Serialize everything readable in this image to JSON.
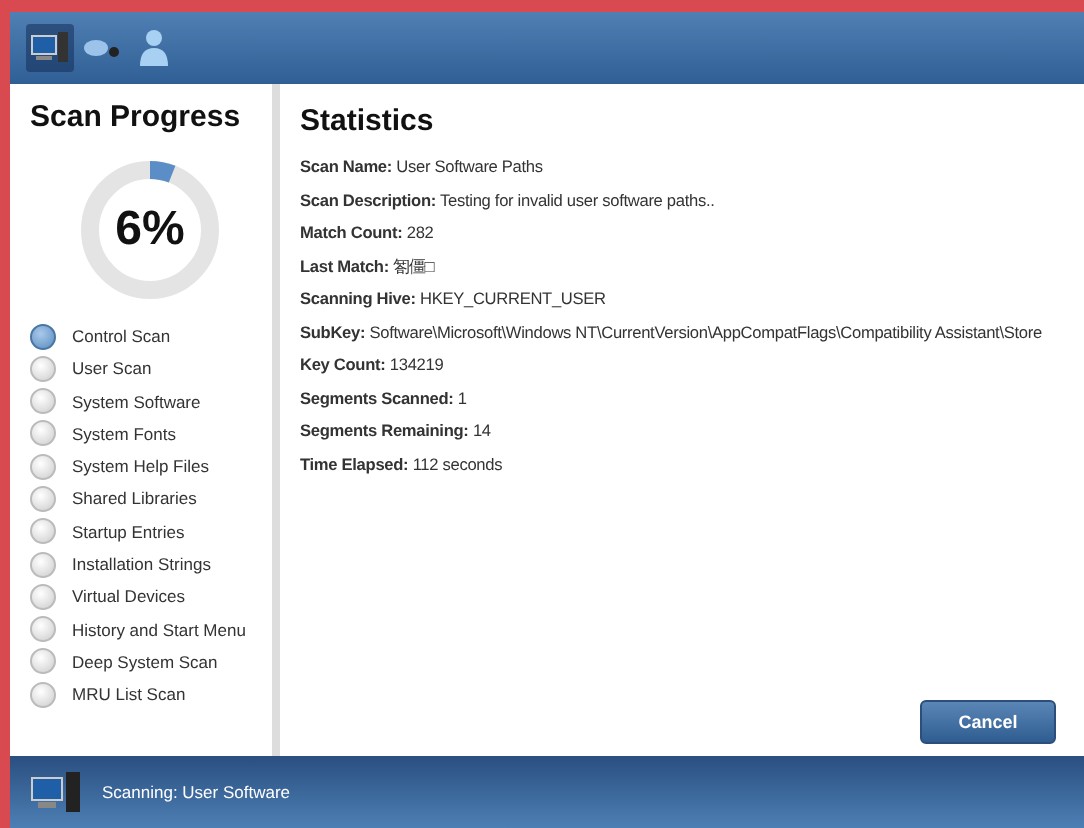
{
  "toolbar": {
    "items": [
      {
        "kind": "computer",
        "selected": true
      },
      {
        "kind": "mouse",
        "selected": false
      },
      {
        "kind": "user",
        "selected": false
      }
    ]
  },
  "sidebar": {
    "title": "Scan Progress",
    "progress": {
      "level": 0.06,
      "reading": "6%"
    },
    "scans": [
      {
        "label": "Control Scan",
        "active": true
      },
      {
        "label": "User Scan",
        "active": false
      },
      {
        "label": "System Software",
        "active": false
      },
      {
        "label": "System Fonts",
        "active": false
      },
      {
        "label": "System Help Files",
        "active": false
      },
      {
        "label": "Shared Libraries",
        "active": false
      },
      {
        "label": "Startup Entries",
        "active": false
      },
      {
        "label": "Installation Strings",
        "active": false
      },
      {
        "label": "Virtual Devices",
        "active": false
      },
      {
        "label": "History and Start Menu",
        "active": false
      },
      {
        "label": "Deep System Scan",
        "active": false
      },
      {
        "label": "MRU List Scan",
        "active": false
      }
    ]
  },
  "statistics": {
    "title": "Statistics",
    "rows": [
      {
        "label": "Scan Name:",
        "value": "User Software Paths"
      },
      {
        "label": "Scan Description:",
        "value": "Testing for invalid user software paths.."
      },
      {
        "label": "Match Count:",
        "value": "282"
      },
      {
        "label": "Last Match:",
        "value": "匒僵□"
      },
      {
        "label": "Scanning Hive:",
        "value": "HKEY_CURRENT_USER"
      },
      {
        "label": "SubKey:",
        "value": "Software\\Microsoft\\Windows NT\\CurrentVersion\\AppCompatFlags\\Compatibility Assistant\\Store"
      },
      {
        "label": "Key Count:",
        "value": "134219"
      },
      {
        "label": "Segments Scanned:",
        "value": "1"
      },
      {
        "label": "Segments Remaining:",
        "value": "14"
      },
      {
        "label": "Time Elapsed:",
        "value": "112 seconds"
      }
    ]
  },
  "cancel_button": "Cancel",
  "status_bar": {
    "text": "Scanning: User Software"
  }
}
